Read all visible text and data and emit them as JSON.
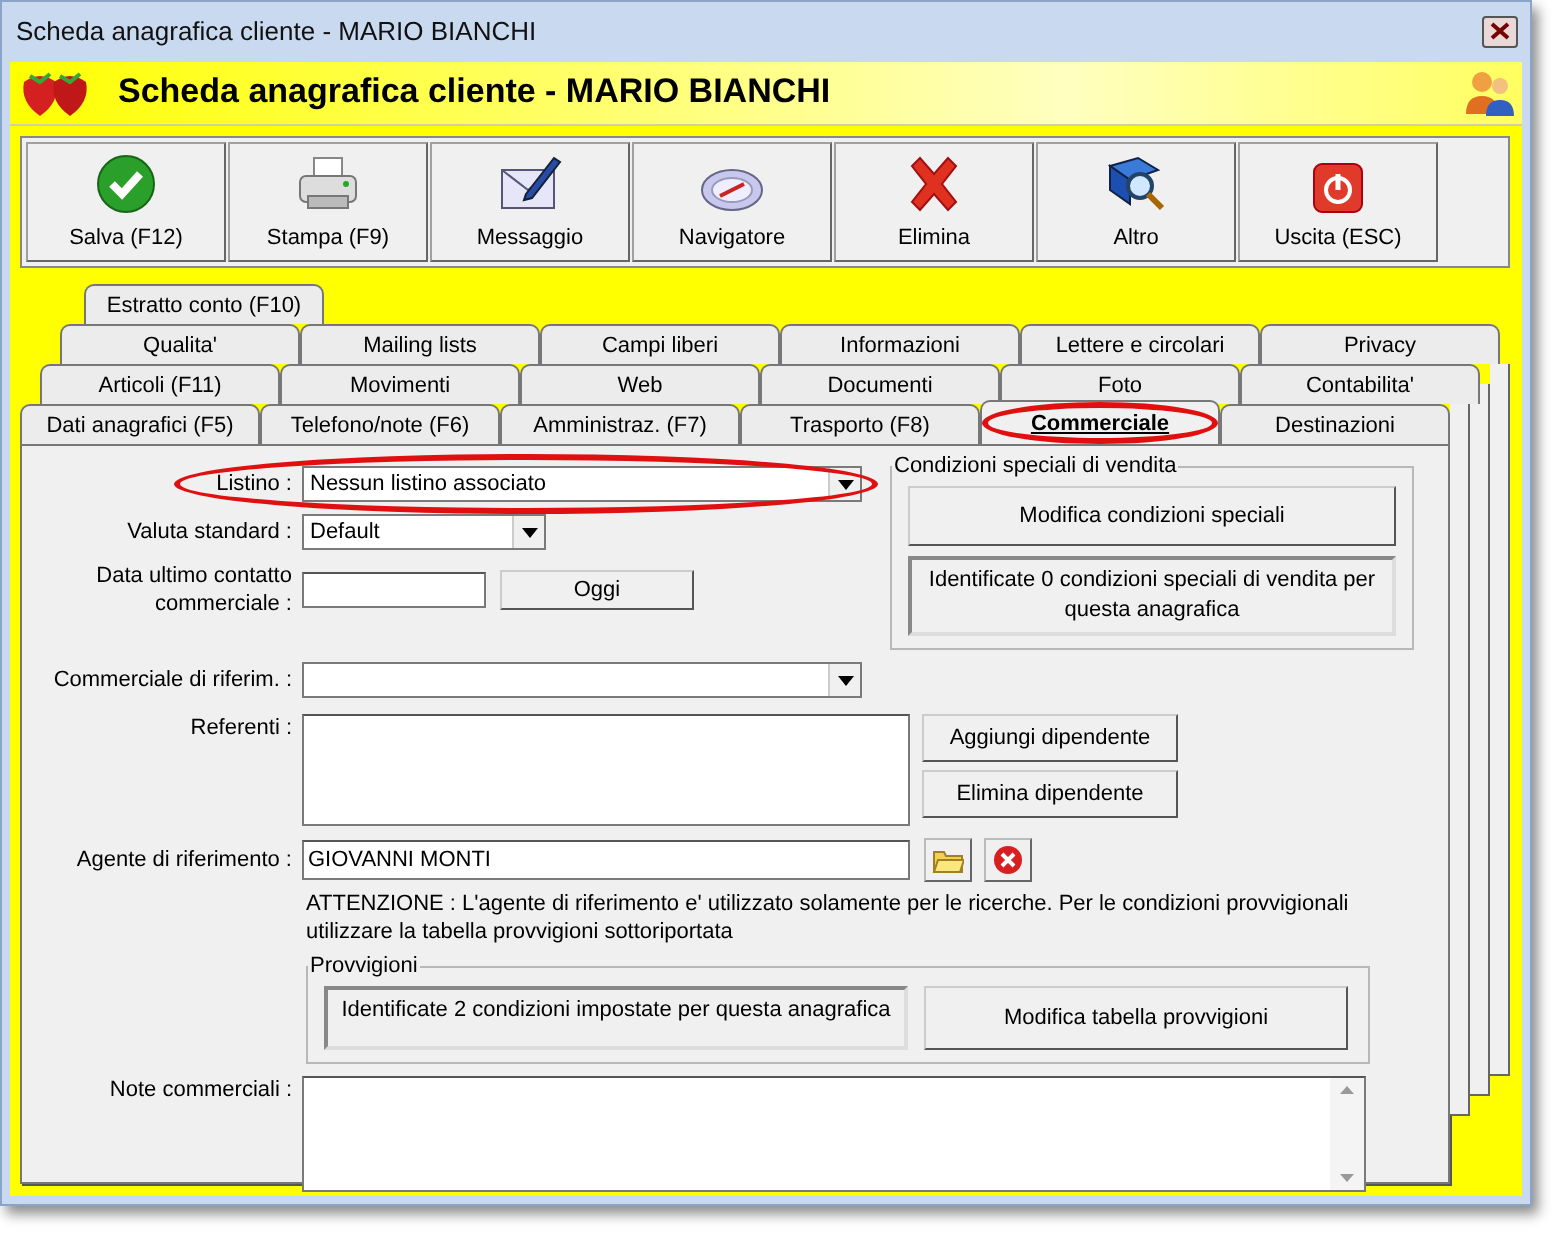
{
  "window": {
    "title": "Scheda anagrafica cliente - MARIO BIANCHI"
  },
  "header": {
    "title": "Scheda anagrafica cliente - MARIO BIANCHI"
  },
  "toolbar": [
    {
      "label": "Salva (F12)",
      "kind": "check"
    },
    {
      "label": "Stampa (F9)",
      "kind": "printer"
    },
    {
      "label": "Messaggio",
      "kind": "mail"
    },
    {
      "label": "Navigatore",
      "kind": "compass"
    },
    {
      "label": "Elimina",
      "kind": "cross"
    },
    {
      "label": "Altro",
      "kind": "book"
    },
    {
      "label": "Uscita (ESC)",
      "kind": "power"
    }
  ],
  "tab_rows": [
    [
      {
        "label": "Estratto conto (F10)",
        "selected": false,
        "highlighted": false
      }
    ],
    [
      {
        "label": "Qualita'",
        "selected": false,
        "highlighted": false
      },
      {
        "label": "Mailing lists",
        "selected": false,
        "highlighted": false
      },
      {
        "label": "Campi liberi",
        "selected": false,
        "highlighted": false
      },
      {
        "label": "Informazioni",
        "selected": false,
        "highlighted": false
      },
      {
        "label": "Lettere e circolari",
        "selected": false,
        "highlighted": false
      },
      {
        "label": "Privacy",
        "selected": false,
        "highlighted": false
      }
    ],
    [
      {
        "label": "Articoli (F11)",
        "selected": false,
        "highlighted": false
      },
      {
        "label": "Movimenti",
        "selected": false,
        "highlighted": false
      },
      {
        "label": "Web",
        "selected": false,
        "highlighted": false
      },
      {
        "label": "Documenti",
        "selected": false,
        "highlighted": false
      },
      {
        "label": "Foto",
        "selected": false,
        "highlighted": false
      },
      {
        "label": "Contabilita'",
        "selected": false,
        "highlighted": false
      }
    ],
    [
      {
        "label": "Dati anagrafici (F5)",
        "selected": false,
        "highlighted": false
      },
      {
        "label": "Telefono/note (F6)",
        "selected": false,
        "highlighted": false
      },
      {
        "label": "Amministraz. (F7)",
        "selected": false,
        "highlighted": false
      },
      {
        "label": "Trasporto (F8)",
        "selected": false,
        "highlighted": false
      },
      {
        "label": "Commerciale",
        "selected": true,
        "highlighted": true
      },
      {
        "label": "Destinazioni",
        "selected": false,
        "highlighted": false
      }
    ]
  ],
  "form": {
    "listino": {
      "label": "Listino :",
      "value": "Nessun listino associato",
      "highlighted": true
    },
    "valuta": {
      "label": "Valuta standard :",
      "value": "Default"
    },
    "data_contatto": {
      "label": "Data ultimo contatto commerciale :",
      "button": "Oggi"
    },
    "condizioni": {
      "title": "Condizioni speciali di vendita",
      "button": "Modifica condizioni speciali",
      "info": "Identificate 0 condizioni speciali di vendita per questa anagrafica"
    },
    "commerciale": {
      "label": "Commerciale di riferim. :"
    },
    "referenti": {
      "label": "Referenti :",
      "buttons": [
        "Aggiungi dipendente",
        "Elimina dipendente"
      ]
    },
    "agente": {
      "label": "Agente di riferimento :",
      "value": "GIOVANNI MONTI"
    },
    "avviso": "ATTENZIONE : L'agente di riferimento e' utilizzato solamente per le ricerche. Per le condizioni provvigionali utilizzare la tabella provvigioni sottoriportata",
    "provvigioni": {
      "title": "Provvigioni",
      "info": "Identificate 2 condizioni impostate per questa anagrafica",
      "button": "Modifica tabella provvigioni"
    },
    "note": {
      "label": "Note commerciali :"
    }
  }
}
